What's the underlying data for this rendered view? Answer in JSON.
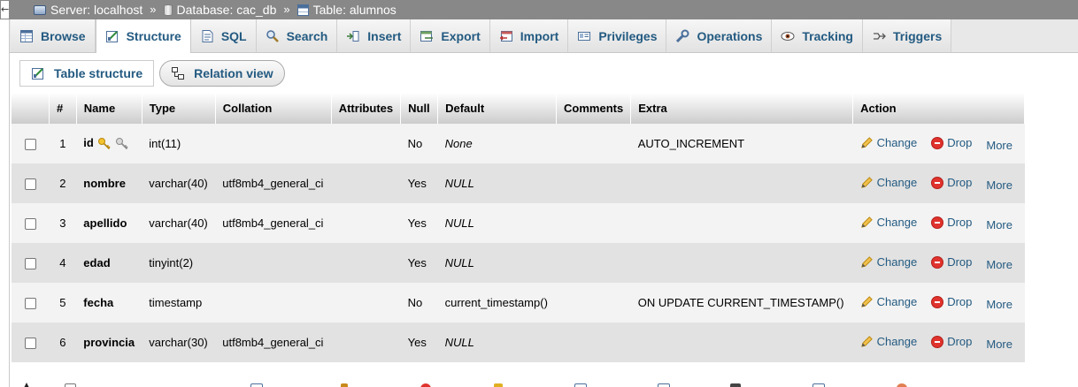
{
  "breadcrumb": {
    "collapse_glyph": "←",
    "server": "Server: localhost",
    "database": "Database: cac_db",
    "table": "Table: alumnos",
    "separator": "»"
  },
  "tabs": [
    {
      "label": "Browse",
      "icon": "browse-icon"
    },
    {
      "label": "Structure",
      "icon": "structure-icon",
      "active": true
    },
    {
      "label": "SQL",
      "icon": "sql-icon"
    },
    {
      "label": "Search",
      "icon": "search-icon"
    },
    {
      "label": "Insert",
      "icon": "insert-icon"
    },
    {
      "label": "Export",
      "icon": "export-icon"
    },
    {
      "label": "Import",
      "icon": "import-icon"
    },
    {
      "label": "Privileges",
      "icon": "privileges-icon"
    },
    {
      "label": "Operations",
      "icon": "wrench-icon"
    },
    {
      "label": "Tracking",
      "icon": "eye-icon"
    },
    {
      "label": "Triggers",
      "icon": "triggers-icon"
    }
  ],
  "subtabs": {
    "structure": "Table structure",
    "relation": "Relation view"
  },
  "table": {
    "headers": [
      "#",
      "Name",
      "Type",
      "Collation",
      "Attributes",
      "Null",
      "Default",
      "Comments",
      "Extra",
      "Action"
    ],
    "rows": [
      {
        "num": "1",
        "name": "id",
        "type": "int(11)",
        "collation": "",
        "attributes": "",
        "null": "No",
        "default": "None",
        "comments": "",
        "extra": "AUTO_INCREMENT",
        "key": true
      },
      {
        "num": "2",
        "name": "nombre",
        "type": "varchar(40)",
        "collation": "utf8mb4_general_ci",
        "attributes": "",
        "null": "Yes",
        "default": "NULL",
        "comments": "",
        "extra": ""
      },
      {
        "num": "3",
        "name": "apellido",
        "type": "varchar(40)",
        "collation": "utf8mb4_general_ci",
        "attributes": "",
        "null": "Yes",
        "default": "NULL",
        "comments": "",
        "extra": ""
      },
      {
        "num": "4",
        "name": "edad",
        "type": "tinyint(2)",
        "collation": "",
        "attributes": "",
        "null": "Yes",
        "default": "NULL",
        "comments": "",
        "extra": ""
      },
      {
        "num": "5",
        "name": "fecha",
        "type": "timestamp",
        "collation": "",
        "attributes": "",
        "null": "No",
        "default": "current_timestamp()",
        "comments": "",
        "extra": "ON UPDATE CURRENT_TIMESTAMP()"
      },
      {
        "num": "6",
        "name": "provincia",
        "type": "varchar(30)",
        "collation": "utf8mb4_general_ci",
        "attributes": "",
        "null": "Yes",
        "default": "NULL",
        "comments": "",
        "extra": ""
      }
    ],
    "actions": {
      "change": "Change",
      "drop": "Drop",
      "more": "More"
    }
  },
  "colors": {
    "link": "#235a81",
    "topbar": "#888888",
    "row_odd": "#f3f3f3",
    "row_even": "#e2e2e2",
    "drop": "#e0332d"
  }
}
